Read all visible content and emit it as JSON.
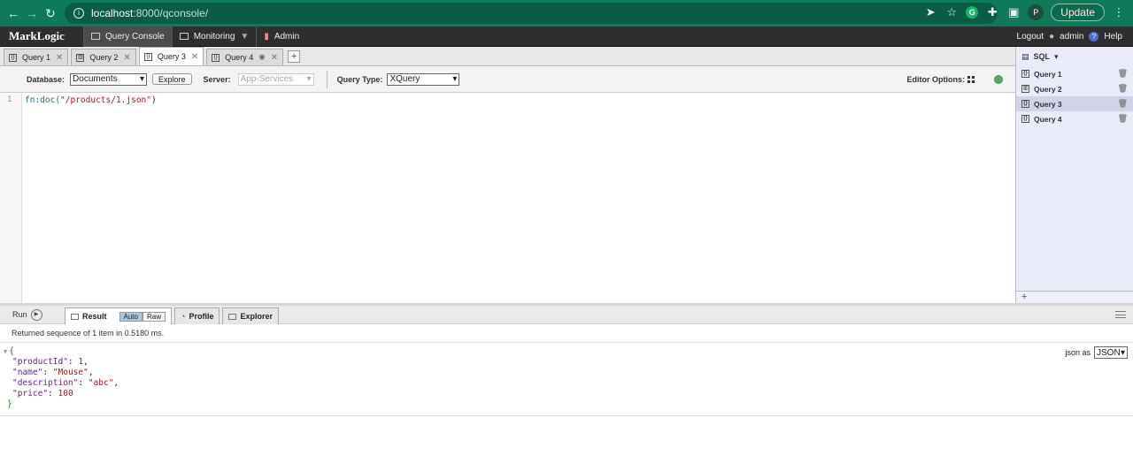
{
  "browser": {
    "url_host": "localhost",
    "url_path": ":8000/qconsole/",
    "update_label": "Update",
    "profile_initial": "P",
    "g_initial": "G"
  },
  "app": {
    "logo": "MarkLogic",
    "tabs": [
      {
        "label": "Query Console"
      },
      {
        "label": "Monitoring"
      },
      {
        "label": "Admin"
      }
    ],
    "logout": "Logout",
    "user": "admin",
    "help": "Help"
  },
  "query_tabs": [
    {
      "label": "Query 1"
    },
    {
      "label": "Query 2"
    },
    {
      "label": "Query 3"
    },
    {
      "label": "Query 4"
    }
  ],
  "toolbar": {
    "database_label": "Database:",
    "database_value": "Documents",
    "explore_label": "Explore",
    "server_label": "Server:",
    "server_value": "App-Services",
    "query_type_label": "Query Type:",
    "query_type_value": "XQuery",
    "editor_options_label": "Editor Options:"
  },
  "editor": {
    "line_number": "1",
    "code_fn": "fn:doc(",
    "code_str": "\"/products/1.json\"",
    "code_end": ")"
  },
  "right_panel": {
    "header": "SQL",
    "items": [
      {
        "label": "Query 1"
      },
      {
        "label": "Query 2"
      },
      {
        "label": "Query 3"
      },
      {
        "label": "Query 4"
      }
    ],
    "add": "+"
  },
  "results": {
    "run_label": "Run",
    "tabs": [
      {
        "label": "Result"
      },
      {
        "label": "Profile"
      },
      {
        "label": "Explorer"
      }
    ],
    "auto_label": "Auto",
    "raw_label": "Raw",
    "status": "Returned sequence of 1 item in 0.5180 ms.",
    "json_as_label": "json as",
    "json_as_value": "JSON",
    "json_lines": [
      {
        "key": "\"productId\"",
        "value": "1",
        "comma": ","
      },
      {
        "key": "\"name\"",
        "value": "\"Mouse\"",
        "comma": ","
      },
      {
        "key": "\"description\"",
        "value": "\"abc\"",
        "comma": ","
      },
      {
        "key": "\"price\"",
        "value": "100",
        "comma": ""
      }
    ],
    "open_brace": "{",
    "close_brace": "}"
  }
}
